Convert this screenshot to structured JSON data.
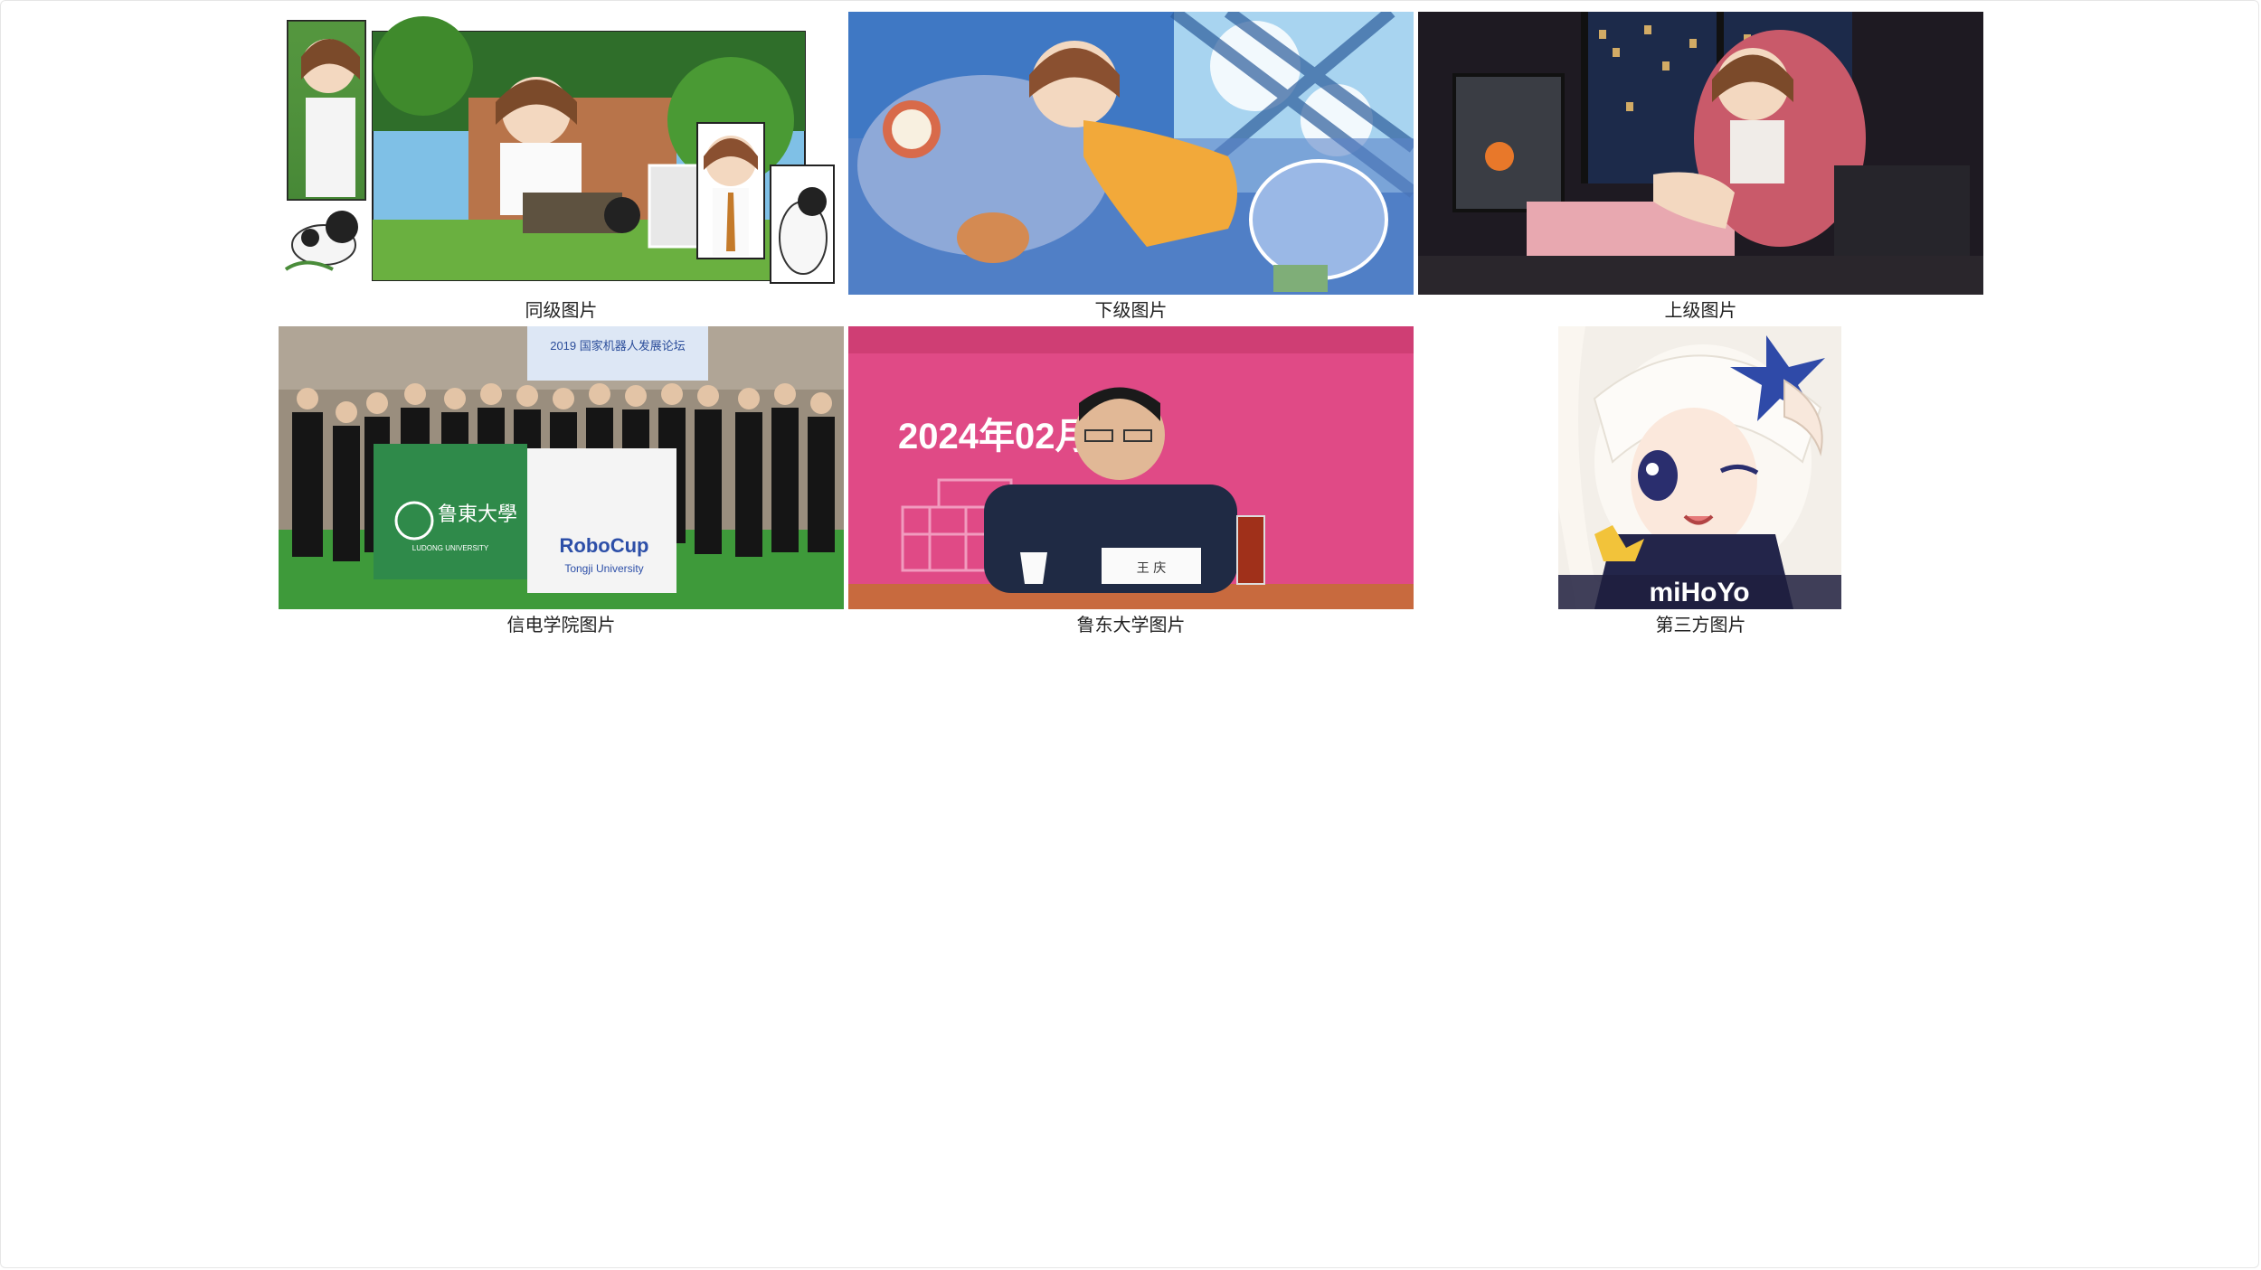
{
  "gallery": {
    "items": [
      {
        "caption": "同级图片",
        "icon": "anime-comic-panels-image"
      },
      {
        "caption": "下级图片",
        "icon": "anime-girl-sleeping-image"
      },
      {
        "caption": "上级图片",
        "icon": "anime-girl-night-room-image"
      },
      {
        "caption": "信电学院图片",
        "icon": "group-photo-robocup-image",
        "banner_text": "2019 国家机器人发展论坛",
        "flag_left": "鲁東大學",
        "flag_left_sub": "LUDONG UNIVERSITY",
        "flag_right": "RoboCup",
        "flag_right_sub": "Tongji University"
      },
      {
        "caption": "鲁东大学图片",
        "icon": "conference-speaker-image",
        "banner_date": "2024年02月 日",
        "nameplate": "王 庆"
      },
      {
        "caption": "第三方图片",
        "icon": "mihoyo-paimon-image",
        "logo_text": "miHoYo"
      }
    ]
  }
}
